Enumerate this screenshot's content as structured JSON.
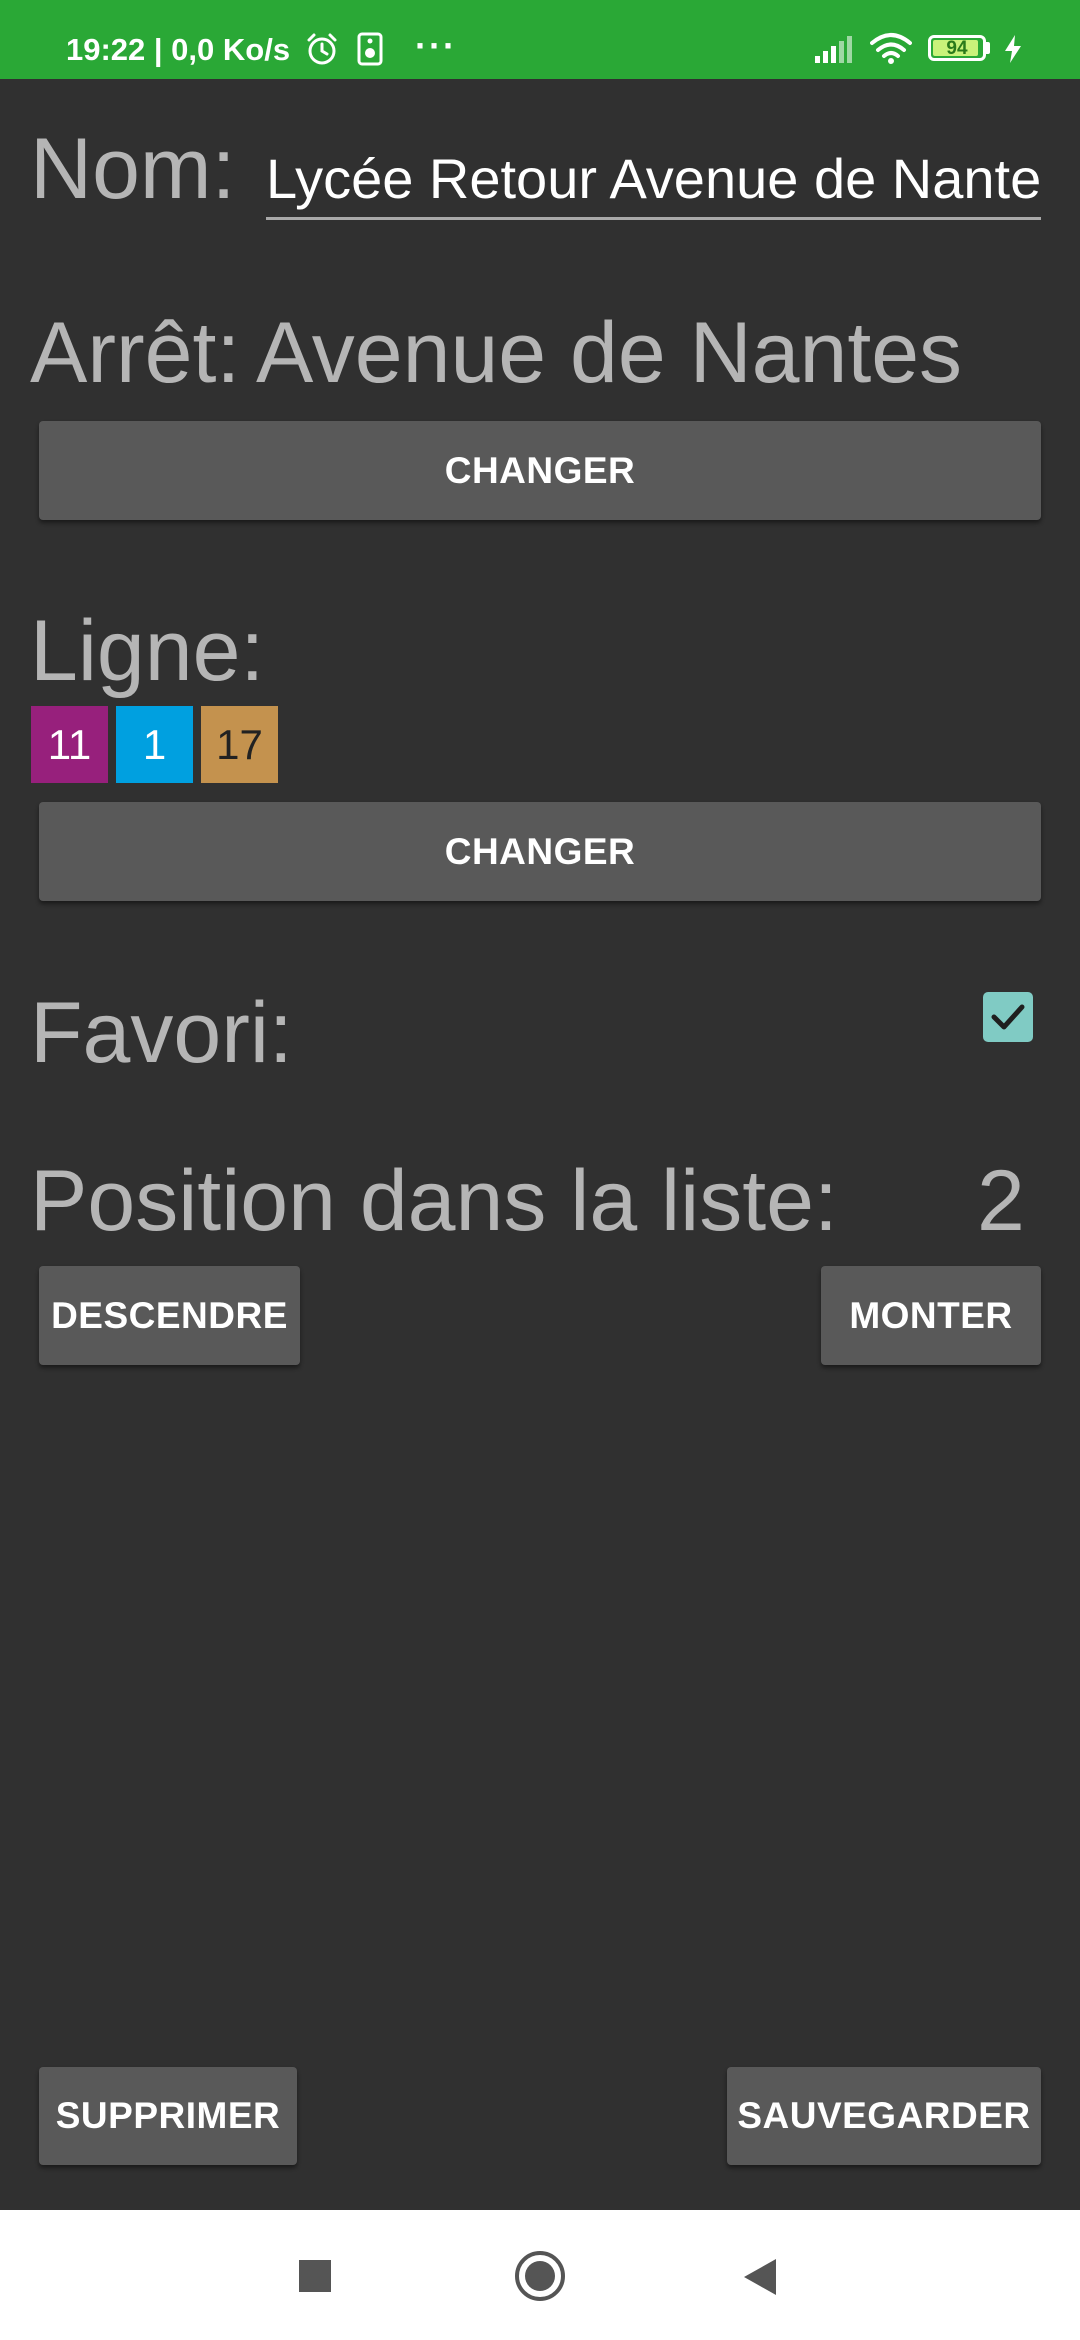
{
  "status_bar": {
    "time_and_speed": "19:22 | 0,0 Ko/s",
    "more_dots": "···",
    "battery_level": "94",
    "battery_fraction": 0.94,
    "background_color": "#2aa836",
    "icons": [
      "alarm-icon",
      "speaker-icon",
      "signal-icon",
      "wifi-icon",
      "battery-icon",
      "charging-icon"
    ]
  },
  "form": {
    "name_label": "Nom:",
    "name_value": "Lycée Retour Avenue de Nantes",
    "stop_label": "Arrêt:",
    "stop_value": "Avenue de Nantes",
    "change_stop_button": "CHANGER",
    "line_label": "Ligne:",
    "lines": [
      {
        "number": "11",
        "color": "#97207c",
        "text_color": "#ffffff"
      },
      {
        "number": "1",
        "color": "#00a0e0",
        "text_color": "#ffffff"
      },
      {
        "number": "17",
        "color": "#c4924e",
        "text_color": "#222222"
      }
    ],
    "change_line_button": "CHANGER",
    "favorite_label": "Favori:",
    "favorite_checked": true,
    "checkbox_color": "#80cbc4",
    "position_label": "Position dans la liste:",
    "position_value": "2",
    "down_button": "DESCENDRE",
    "up_button": "MONTER"
  },
  "actions": {
    "delete_button": "SUPPRIMER",
    "save_button": "SAUVEGARDER"
  },
  "nav_bar": {
    "icons": [
      "recents-square-icon",
      "home-circle-icon",
      "back-triangle-icon"
    ]
  }
}
